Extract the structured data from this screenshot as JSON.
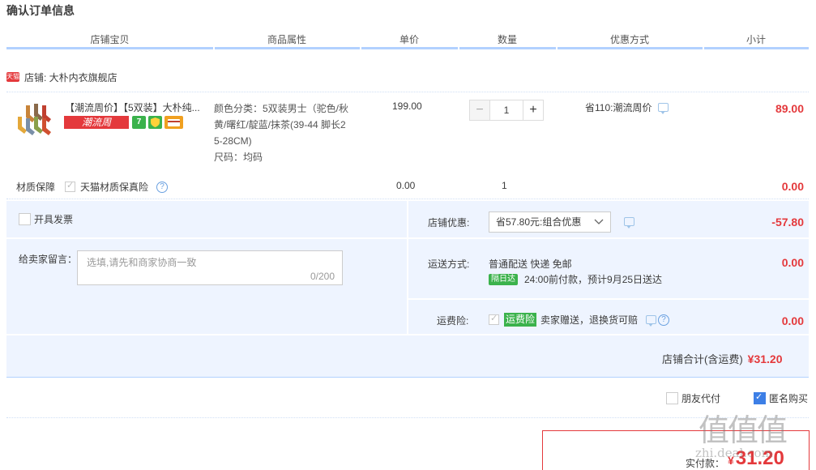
{
  "page_title": "确认订单信息",
  "headers": [
    "店铺宝贝",
    "商品属性",
    "单价",
    "数量",
    "优惠方式",
    "小计"
  ],
  "shop": {
    "badge": "天猫",
    "label": "店铺: 大朴内衣旗舰店"
  },
  "item": {
    "title": "【潮流周价】【5双装】大朴纯...",
    "tag": "潮流周",
    "icon_7": "7",
    "attr_line1": "颜色分类：5双装男士（驼色/秋",
    "attr_line2": "黄/曙红/靛蓝/抹茶(39-44 脚长2",
    "attr_line3": "5-28CM)",
    "attr_size": "尺码：均码",
    "price": "199.00",
    "qty": "1",
    "qty_minus": "−",
    "qty_plus": "+",
    "promo": "省110:潮流周价",
    "subtotal": "89.00"
  },
  "warranty": {
    "label": "材质保障",
    "option": "天猫材质保真险",
    "help": "?",
    "price": "0.00",
    "qty": "1",
    "subtotal": "0.00"
  },
  "invoice": {
    "label": "开具发票"
  },
  "shop_discount": {
    "label": "店铺优惠:",
    "value": "省57.80元:组合优惠",
    "amount": "-57.80"
  },
  "message": {
    "label": "给卖家留言：",
    "placeholder": "选填,请先和商家协商一致",
    "count": "0/200"
  },
  "shipping": {
    "label": "运送方式:",
    "method": "普通配送 快递 免邮",
    "badge": "隔日达",
    "note": "24:00前付款，预计9月25日送达",
    "amount": "0.00"
  },
  "insurance": {
    "label": "运费险:",
    "tag": "运费险",
    "text": "卖家赠送，退换货可赔",
    "amount": "0.00"
  },
  "shop_total": {
    "label": "店铺合计(含运费)",
    "amount": "¥31.20"
  },
  "options": {
    "friend_pay": "朋友代付",
    "anonymous": "匿名购买"
  },
  "payment": {
    "label": "实付款：",
    "currency": "¥",
    "amount": "31.20"
  },
  "watermark": {
    "text": "值值值",
    "url": "zhi.deal.com"
  },
  "colors": {
    "accent_red": "#e4393c",
    "header_line": "#b2d1ff",
    "panel_bg": "#eef4ff",
    "green": "#3bb24c"
  }
}
